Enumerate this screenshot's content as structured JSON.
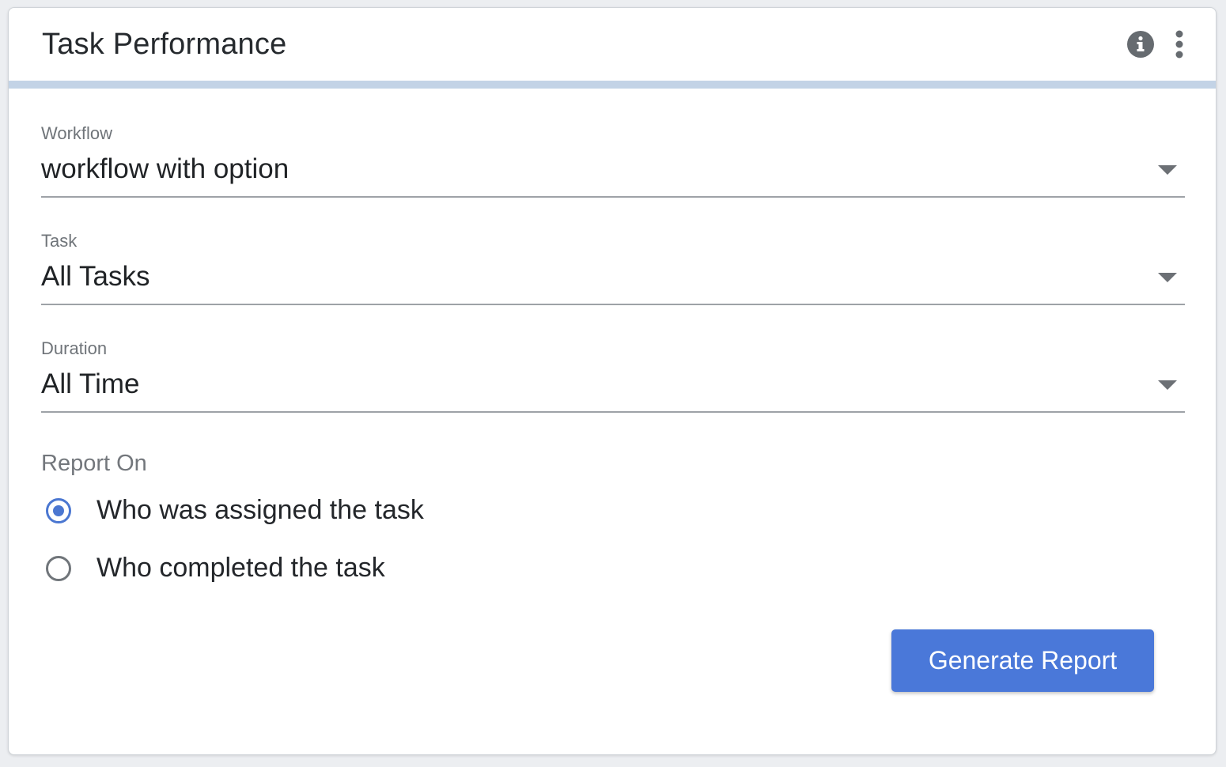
{
  "header": {
    "title": "Task Performance"
  },
  "form": {
    "workflow": {
      "label": "Workflow",
      "value": "workflow with option"
    },
    "task": {
      "label": "Task",
      "value": "All Tasks"
    },
    "duration": {
      "label": "Duration",
      "value": "All Time"
    },
    "report_on": {
      "label": "Report On",
      "options": [
        {
          "label": "Who was assigned the task",
          "selected": true
        },
        {
          "label": "Who completed the task",
          "selected": false
        }
      ]
    },
    "submit_label": "Generate Report"
  },
  "colors": {
    "accent": "#4a78d9",
    "header_bar": "#c3d3e6"
  },
  "icons": [
    "info-icon",
    "more-vertical-icon",
    "dropdown-arrow-icon",
    "radio-icon"
  ]
}
